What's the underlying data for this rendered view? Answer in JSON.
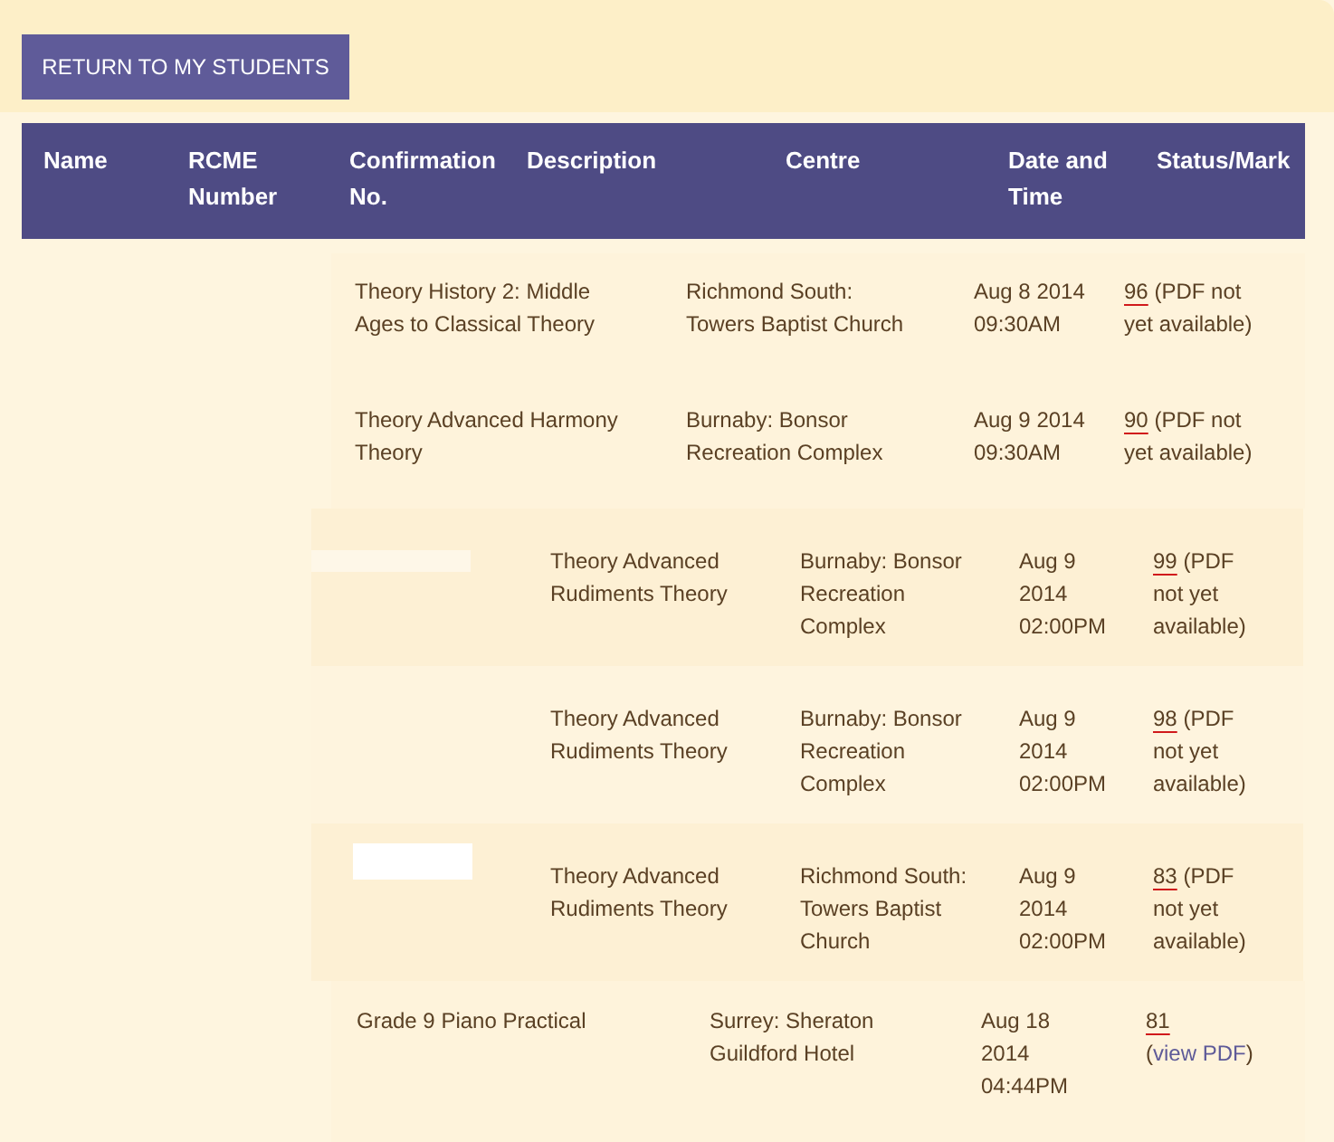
{
  "return_button": "RETURN TO MY STUDENTS",
  "table": {
    "columns": [
      "Name",
      "RCME Number",
      "Confirmation No.",
      "Description",
      "Centre",
      "Date and Time",
      "Status/Mark"
    ],
    "rows": [
      {
        "kind": "wide",
        "description": "Theory History 2: Middle Ages to Classical Theory",
        "centre": "Richmond South: Towers Baptist Church",
        "date": "Aug 8 2014 09:30AM",
        "mark": "96",
        "note": "(PDF not yet available)"
      },
      {
        "kind": "wide",
        "description": "Theory Advanced Harmony Theory",
        "centre": "Burnaby: Bonsor Recreation Complex",
        "date": "Aug 9 2014 09:30AM",
        "mark": "90",
        "note": "(PDF not yet available)"
      },
      {
        "kind": "nested",
        "name_hidden": true,
        "description": "Theory Advanced Rudiments Theory",
        "centre": "Burnaby: Bonsor Recreation Complex",
        "date": "Aug 9 2014 02:00PM",
        "mark": "99",
        "note": "(PDF not yet available)"
      },
      {
        "kind": "nested",
        "name_hidden": false,
        "description": "Theory Advanced Rudiments Theory",
        "centre": "Burnaby: Bonsor Recreation Complex",
        "date": "Aug 9 2014 02:00PM",
        "mark": "98",
        "note": "(PDF not yet available)"
      },
      {
        "kind": "nested",
        "name_hidden": true,
        "description": "Theory Advanced Rudiments Theory",
        "centre": "Richmond South: Towers Baptist Church",
        "date": "Aug 9 2014 02:00PM",
        "mark": "83",
        "note": "(PDF not yet available)"
      },
      {
        "kind": "practical",
        "description": "Grade 9 Piano Practical",
        "centre": "Surrey: Sheraton Guildford Hotel",
        "date": "Aug 18 2014 04:44PM",
        "mark": "81",
        "before": "(",
        "link": "view PDF",
        "after": ")"
      }
    ]
  }
}
